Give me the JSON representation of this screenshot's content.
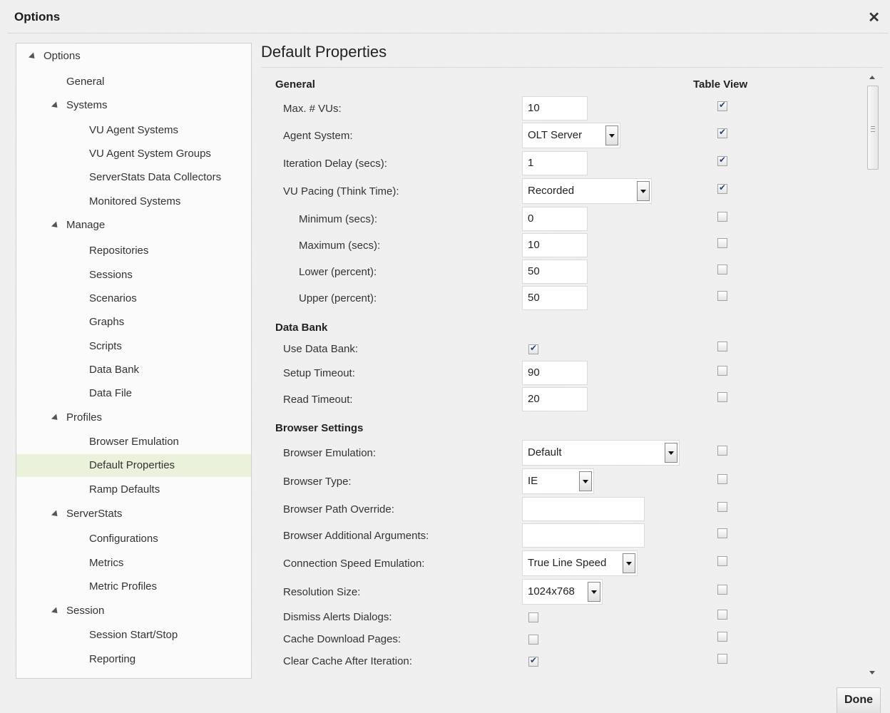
{
  "window": {
    "title": "Options",
    "close_glyph": "✕"
  },
  "tree": {
    "items": [
      {
        "label": "Options",
        "level": 0,
        "expanded": true
      },
      {
        "label": "General",
        "level": 1
      },
      {
        "label": "Systems",
        "level": 1,
        "expanded": true
      },
      {
        "label": "VU Agent Systems",
        "level": 2
      },
      {
        "label": "VU Agent System Groups",
        "level": 2
      },
      {
        "label": "ServerStats Data Collectors",
        "level": 2
      },
      {
        "label": "Monitored Systems",
        "level": 2
      },
      {
        "label": "Manage",
        "level": 1,
        "expanded": true
      },
      {
        "label": "Repositories",
        "level": 2
      },
      {
        "label": "Sessions",
        "level": 2
      },
      {
        "label": "Scenarios",
        "level": 2
      },
      {
        "label": "Graphs",
        "level": 2
      },
      {
        "label": "Scripts",
        "level": 2
      },
      {
        "label": "Data Bank",
        "level": 2
      },
      {
        "label": "Data File",
        "level": 2
      },
      {
        "label": "Profiles",
        "level": 1,
        "expanded": true
      },
      {
        "label": "Browser Emulation",
        "level": 2
      },
      {
        "label": "Default Properties",
        "level": 2,
        "selected": true
      },
      {
        "label": "Ramp Defaults",
        "level": 2
      },
      {
        "label": "ServerStats",
        "level": 1,
        "expanded": true
      },
      {
        "label": "Configurations",
        "level": 2
      },
      {
        "label": "Metrics",
        "level": 2
      },
      {
        "label": "Metric Profiles",
        "level": 2
      },
      {
        "label": "Session",
        "level": 1,
        "expanded": true
      },
      {
        "label": "Session Start/Stop",
        "level": 2
      },
      {
        "label": "Reporting",
        "level": 2
      }
    ]
  },
  "main": {
    "heading": "Default Properties",
    "table_view_header": "Table View",
    "sections": {
      "general": "General",
      "data_bank": "Data Bank",
      "browser_settings": "Browser Settings"
    },
    "rows": [
      {
        "label": "Max. # VUs:",
        "control": "text",
        "value": "10",
        "table_view": true
      },
      {
        "label": "Agent System:",
        "control": "select",
        "value": "OLT Server",
        "table_view": true
      },
      {
        "label": "Iteration Delay (secs):",
        "control": "text",
        "value": "1",
        "table_view": true
      },
      {
        "label": "VU Pacing (Think Time):",
        "control": "select",
        "value": "Recorded",
        "table_view": true
      },
      {
        "label": "Minimum (secs):",
        "control": "text",
        "value": "0",
        "table_view": false
      },
      {
        "label": "Maximum (secs):",
        "control": "text",
        "value": "10",
        "table_view": false
      },
      {
        "label": "Lower (percent):",
        "control": "text",
        "value": "50",
        "table_view": false
      },
      {
        "label": "Upper (percent):",
        "control": "text",
        "value": "50",
        "table_view": false
      },
      {
        "label": "Use Data Bank:",
        "control": "checkbox",
        "checked": true,
        "table_view": false
      },
      {
        "label": "Setup Timeout:",
        "control": "text",
        "value": "90",
        "table_view": false
      },
      {
        "label": "Read Timeout:",
        "control": "text",
        "value": "20",
        "table_view": false
      },
      {
        "label": "Browser Emulation:",
        "control": "select",
        "value": "Default",
        "table_view": false
      },
      {
        "label": "Browser Type:",
        "control": "select",
        "value": "IE",
        "table_view": false
      },
      {
        "label": "Browser Path Override:",
        "control": "text",
        "value": "",
        "table_view": false
      },
      {
        "label": "Browser Additional Arguments:",
        "control": "text",
        "value": "",
        "table_view": false
      },
      {
        "label": "Connection Speed Emulation:",
        "control": "select",
        "value": "True Line Speed",
        "table_view": false
      },
      {
        "label": "Resolution Size:",
        "control": "select",
        "value": "1024x768",
        "table_view": false
      },
      {
        "label": "Dismiss Alerts Dialogs:",
        "control": "checkbox",
        "checked": false,
        "table_view": false
      },
      {
        "label": "Cache Download Pages:",
        "control": "checkbox",
        "checked": false,
        "table_view": false
      },
      {
        "label": "Clear Cache After Iteration:",
        "control": "checkbox",
        "checked": true,
        "table_view": false
      }
    ]
  },
  "footer": {
    "done_label": "Done"
  },
  "colors": {
    "selected_row": "#eaf2dc",
    "check_mark": "#2c3f80"
  }
}
